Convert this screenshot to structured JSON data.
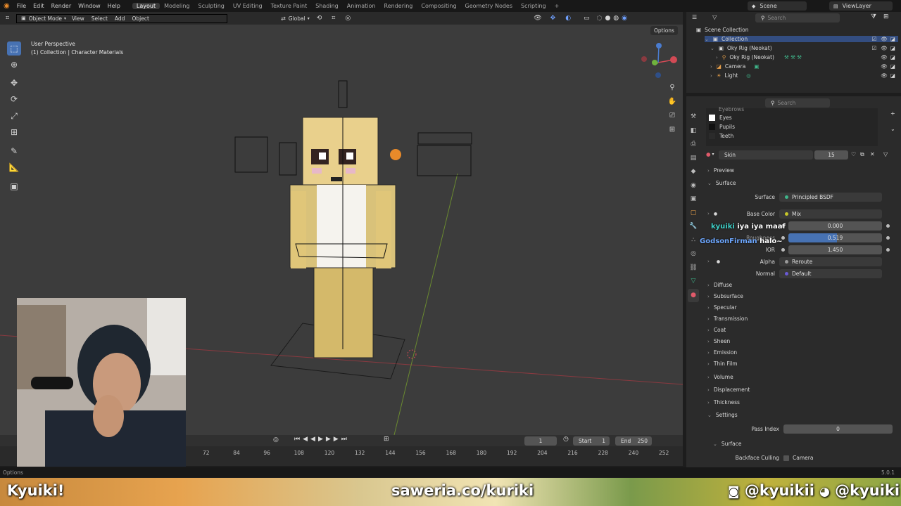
{
  "menu": {
    "items": [
      "File",
      "Edit",
      "Render",
      "Window",
      "Help"
    ],
    "workspaces": [
      "Layout",
      "Modeling",
      "Sculpting",
      "UV Editing",
      "Texture Paint",
      "Shading",
      "Animation",
      "Rendering",
      "Compositing",
      "Geometry Nodes",
      "Scripting"
    ],
    "active_workspace": "Layout",
    "add_tab": "+",
    "scene": "Scene",
    "view_layer": "ViewLayer"
  },
  "viewport": {
    "mode": "Object Mode",
    "menus": [
      "View",
      "Select",
      "Add",
      "Object"
    ],
    "orientation": "Global",
    "options": "Options",
    "perspective": "User Perspective",
    "collection_info": "(1) Collection | Character Materials"
  },
  "timeline": {
    "current_frame": "1",
    "start_label": "Start",
    "start": "1",
    "end_label": "End",
    "end": "250",
    "ticks": [
      "72",
      "84",
      "96",
      "108",
      "120",
      "132",
      "144",
      "156",
      "168",
      "180",
      "192",
      "204",
      "216",
      "228",
      "240",
      "252"
    ]
  },
  "outliner": {
    "search_placeholder": "Search",
    "root": "Scene Collection",
    "collection": "Collection",
    "items": [
      "Oky Rig (Neokat)",
      "Oky Rig (Neokat)",
      "Camera",
      "Light"
    ]
  },
  "properties": {
    "search_placeholder": "Search",
    "material_slots": [
      "Eyebrows",
      "Eyes",
      "Pupils",
      "Teeth"
    ],
    "material_name": "Skin",
    "users": "15",
    "preview": "Preview",
    "surface_section": "Surface",
    "surface_label": "Surface",
    "surface_value": "Principled BSDF",
    "base_color_label": "Base Color",
    "base_color_value": "Mix",
    "metallic_value": "0.000",
    "roughness_label": "Roughness",
    "roughness_value": "0.519",
    "roughness_fraction": 0.519,
    "ior_label": "IOR",
    "ior_value": "1.450",
    "alpha_label": "Alpha",
    "alpha_value": "Reroute",
    "normal_label": "Normal",
    "normal_value": "Default",
    "subsections": [
      "Diffuse",
      "Subsurface",
      "Specular",
      "Transmission",
      "Coat",
      "Sheen",
      "Emission",
      "Thin Film"
    ],
    "volume": "Volume",
    "displacement": "Displacement",
    "thickness": "Thickness",
    "settings": "Settings",
    "pass_index_label": "Pass Index",
    "pass_index_value": "0",
    "surface_sub": "Surface",
    "backface_label": "Backface Culling",
    "backface_value": "Camera"
  },
  "chat": {
    "msg1_user": "kyuiki",
    "msg1_text": "iya iya maaf",
    "msg2_user": "GodsonFirman",
    "msg2_text": "halo~"
  },
  "status": {
    "left": "Options",
    "version": "5.0.1"
  },
  "banner": {
    "name": "Kyuiki!",
    "donate": "saweria.co/kuriki",
    "instagram": "@kyuikii",
    "discord": "@kyuiki"
  },
  "colors": {
    "accent": "#4772b3",
    "active_blue": "#4a7ccf",
    "chat_user1": "#3fd0c8",
    "chat_user2": "#6ea8ff"
  }
}
